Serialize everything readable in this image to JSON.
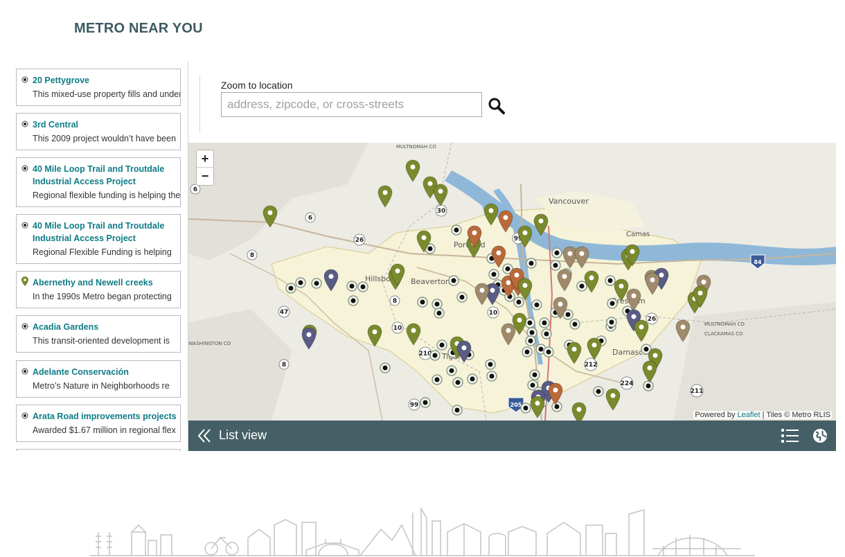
{
  "page": {
    "title": "METRO NEAR YOU"
  },
  "sidebar": {
    "items": [
      {
        "title": "20 Pettygrove",
        "desc": "This mixed-use property fills and under",
        "marker": "circle-dot-icon"
      },
      {
        "title": "3rd Central",
        "desc": "This 2009 project wouldn’t have been",
        "marker": "circle-dot-icon"
      },
      {
        "title": "40 Mile Loop Trail and Troutdale Industrial Access Project",
        "desc": "Regional flexible funding is helping the",
        "marker": "circle-dot-icon"
      },
      {
        "title": "40 Mile Loop Trail and Troutdale Industrial Access Project",
        "desc": "Regional Flexible Funding is helping",
        "marker": "circle-dot-icon"
      },
      {
        "title": "Abernethy and Newell creeks",
        "desc": "In the 1990s Metro began protecting",
        "marker": "map-pin-icon"
      },
      {
        "title": "Acadia Gardens",
        "desc": "This transit-oriented development is",
        "marker": "circle-dot-icon"
      },
      {
        "title": "Adelante Conservación",
        "desc": "Metro’s Nature in Neighborhoods re",
        "marker": "circle-dot-icon"
      },
      {
        "title": "Arata Road improvements projects",
        "desc": "Awarded $1.67 million in regional flex",
        "marker": "circle-dot-icon"
      }
    ]
  },
  "search": {
    "label": "Zoom to location",
    "placeholder": "address, zipcode, or cross-streets",
    "value": ""
  },
  "map": {
    "zoom_in": "+",
    "zoom_out": "−",
    "attribution_prefix": "Powered by",
    "attribution_link": "Leaflet",
    "attribution_suffix": "| Tiles © Metro RLIS",
    "place_labels": [
      "Vancouver",
      "Camas",
      "Portland",
      "Hillsboro",
      "Beaverton",
      "Gresham",
      "Tigard",
      "Damascus",
      "MULTNOMAH CO",
      "WASHINGTON CO",
      "CLACKAMAS CO"
    ],
    "route_shields": [
      "6",
      "30",
      "26",
      "99",
      "8",
      "47",
      "10",
      "210",
      "212",
      "224",
      "211",
      "84",
      "205"
    ],
    "colors": {
      "water": "#8fb8d8",
      "urban": "#f5f2d8",
      "pin_green": "#7a8a2c",
      "pin_orange": "#b9693a",
      "pin_tan": "#a08a6c",
      "pin_purple": "#5a5c86",
      "bar": "#455f66",
      "accent": "#0e7c86"
    }
  },
  "bottom_bar": {
    "list_view": "List view"
  }
}
